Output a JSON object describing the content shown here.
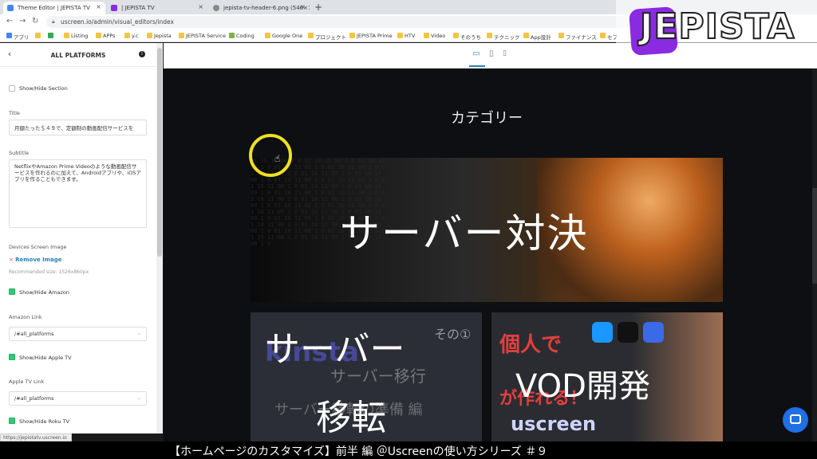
{
  "browser": {
    "tabs": [
      {
        "title": "Theme Editor | JEPISTA TV",
        "favicon_color": "#4285f4",
        "active": true
      },
      {
        "title": "| JEPISTA TV",
        "favicon_color": "#8a2be2",
        "active": false
      },
      {
        "title": "jepista-tv-header-6.png (546×1",
        "favicon_color": "#888888",
        "active": false
      }
    ],
    "new_tab": "+",
    "url": "uscreen.io/admin/visual_editors/index",
    "bookmarks": [
      "アプリ",
      "",
      "",
      "Listing",
      "APPs",
      "y.c",
      "Jepista",
      "JEPISTA Service",
      "Coding",
      "Google One",
      "プロジェクト",
      "JEPISTA Prime",
      "HTV",
      "Video",
      "そのうち",
      "テクニック",
      "App設計",
      "ファイナンス",
      "セブ"
    ]
  },
  "logo": {
    "text": "JEPISTA",
    "badge_color": "#8a2be2"
  },
  "sidebar": {
    "back": "‹",
    "title": "ALL PLATFORMS",
    "info": "i",
    "show_hide_section": "Show/Hide Section",
    "title_label": "Title",
    "title_value": "月額たった＄４９で、定額制の動画配信サービスを",
    "subtitle_label": "Subtitle",
    "subtitle_value": "NetflixやAmazon Prime Videoのような動画配信サービスを作れるのに加えて、Androidアプリや、iOSアプリを作ることもできます。",
    "devices_label": "Devices Screen Image",
    "remove_x": "×",
    "remove_image": "Remove Image",
    "recommended": "Recommended size: 1526x860px",
    "show_amazon": "Show/Hide Amazon",
    "amazon_link_label": "Amazon Link",
    "amazon_link_value": "/#all_platforms",
    "show_appletv": "Show/Hide Apple TV",
    "appletv_link_label": "Apple TV Link",
    "appletv_link_value": "/#all_platforms",
    "show_roku": "Show/Hide Roku TV"
  },
  "status_url": "https://jepistatv.uscreen.io",
  "preview": {
    "category_title": "カテゴリー",
    "card_main_title": "サーバー対決",
    "card_bl_ghost": [
      "kinsta",
      "サーバー移行",
      "サーバー移転の準備 編",
      "その①"
    ],
    "card_bl_title_1": "サーバー",
    "card_bl_title_2": "移転",
    "card_br_ghost": [
      "個人で",
      "が作れる！",
      "uscreen"
    ],
    "card_br_title": "VOD開発"
  },
  "caption": "【ホームページのカスタマイズ】前半 編 ＠Uscreenの使い方シリーズ ＃９",
  "colors": {
    "accent": "#2980b9",
    "toggle_on": "#2ecc71",
    "cursor_ring": "#f1e020",
    "chat": "#1f6fe5"
  }
}
